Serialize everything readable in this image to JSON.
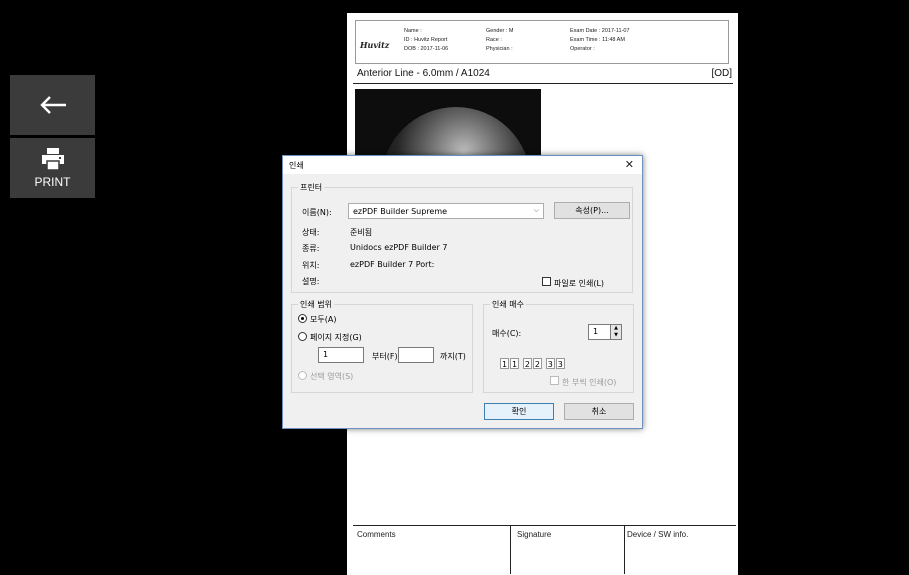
{
  "sidebar": {
    "back_icon": "arrow-left-icon",
    "print_icon": "printer-icon",
    "print_label": "PRINT"
  },
  "report": {
    "logo": "Huvitz",
    "header": {
      "col1": [
        "Name :",
        "ID : Huvitz Report",
        "DOB : 2017-11-06"
      ],
      "col2": [
        "Gender : M",
        "Race :",
        "Physician :"
      ],
      "col3": [
        "Exam Date : 2017-11-07",
        "Exam Time : 11:48 AM",
        "Operator :"
      ]
    },
    "section_title": "Anterior Line - 6.0mm / A1024",
    "eye": "[OD]",
    "footer": {
      "comments": "Comments",
      "signature": "Signature",
      "device": "Device / SW info."
    }
  },
  "dialog": {
    "title": "인쇄",
    "close": "✕",
    "printer": {
      "legend": "프린터",
      "name_label": "이름(N):",
      "name_value": "ezPDF Builder Supreme",
      "properties_button": "속성(P)...",
      "status_label": "상태:",
      "status_value": "준비됨",
      "type_label": "종류:",
      "type_value": "Unidocs ezPDF Builder 7",
      "where_label": "위치:",
      "where_value": "ezPDF Builder 7 Port:",
      "comment_label": "설명:",
      "print_to_file": "파일로 인쇄(L)"
    },
    "range": {
      "legend": "인쇄 범위",
      "all": "모두(A)",
      "pages": "페이지 지정(G)",
      "from_value": "1",
      "from_label": "부터(F)",
      "to_value": "",
      "to_label": "까지(T)",
      "selection": "선택 영역(S)"
    },
    "copies": {
      "legend": "인쇄 매수",
      "count_label": "매수(C):",
      "count_value": "1",
      "collate_label": "한 부씩 인쇄(O)"
    },
    "ok": "확인",
    "cancel": "취소"
  }
}
